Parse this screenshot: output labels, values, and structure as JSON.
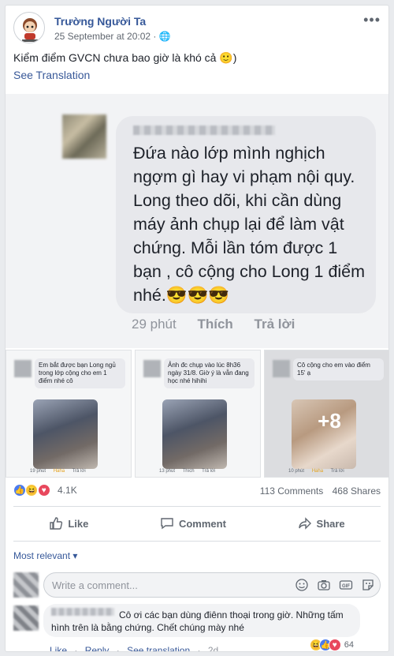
{
  "post": {
    "page_name": "Trường Người Ta",
    "timestamp": "25 September at 20:02",
    "privacy_icon": "globe-icon",
    "text": "Kiểm điểm GVCN chưa bao giờ là khó cả 🙂)",
    "see_translation": "See Translation"
  },
  "screenshot": {
    "comment_text": "Đứa nào lớp mình nghịch ngợm gì hay vi phạm nội quy. Long theo dõi, khi cần dùng máy ảnh chụp lại để làm vật chứng. Mỗi lần tóm được 1 bạn , cô cộng cho Long 1 điểm nhé.😎😎😎",
    "time": "29 phút",
    "like": "Thích",
    "reply": "Trả lời"
  },
  "thumbnails": [
    {
      "text": "Em bắt được bạn Long ngủ trong lớp cộng cho em 1 điểm nhé cô",
      "time": "19 phút",
      "reaction": "Haha",
      "reply": "Trả lời"
    },
    {
      "text": "Ảnh đc chụp vào lúc 8h36 ngày 31/8. Giờ ý là vẫn đang học nhé hihihi",
      "time": "13 phút",
      "reaction": "Thích",
      "reply": "Trả lời"
    },
    {
      "text": "Cô cộng cho em vào điểm 15' ạ",
      "time": "10 phút",
      "reaction": "Haha",
      "reply": "Trả lời",
      "more_count": "+8"
    }
  ],
  "stats": {
    "reactions": "4.1K",
    "comments": "113 Comments",
    "shares": "468 Shares"
  },
  "actions": {
    "like": "Like",
    "comment": "Comment",
    "share": "Share"
  },
  "comments": {
    "sort": "Most relevant",
    "input_placeholder": "Write a comment...",
    "first": {
      "text": "Cô ơi các bạn dùng điênn thoại trong giờ. Những tấm hình trên là bằng chứng. Chết chúng mày nhé",
      "reaction_count": "64",
      "like": "Like",
      "reply": "Reply",
      "see_translation": "See translation",
      "time": "2d"
    }
  },
  "colors": {
    "link": "#365899",
    "bg": "#e9ebee",
    "card": "#ffffff"
  }
}
